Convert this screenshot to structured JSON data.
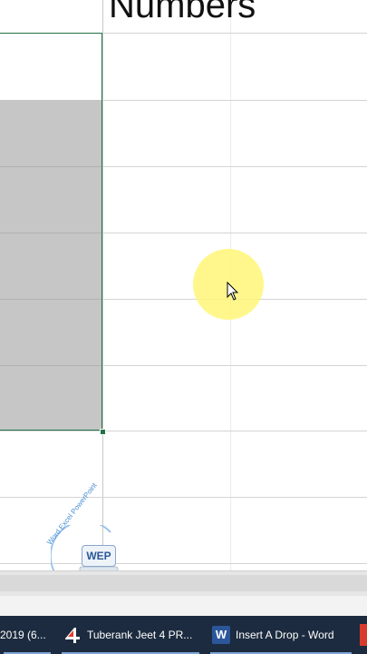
{
  "sheet": {
    "header_cell_text": "Numbers",
    "selection_color": "#217346",
    "shade_color": "#c6c6c6"
  },
  "watermark": {
    "badge": "WEP",
    "arc_text": "Word Excel PowerPoint"
  },
  "taskbar": {
    "items": [
      {
        "label": "2019 (6...",
        "icon": "app-icon"
      },
      {
        "label": "Tuberank Jeet 4 PR...",
        "icon": "tuberank-icon"
      },
      {
        "label": "Insert A Drop - Word",
        "icon": "word-icon",
        "icon_glyph": "W"
      }
    ]
  }
}
